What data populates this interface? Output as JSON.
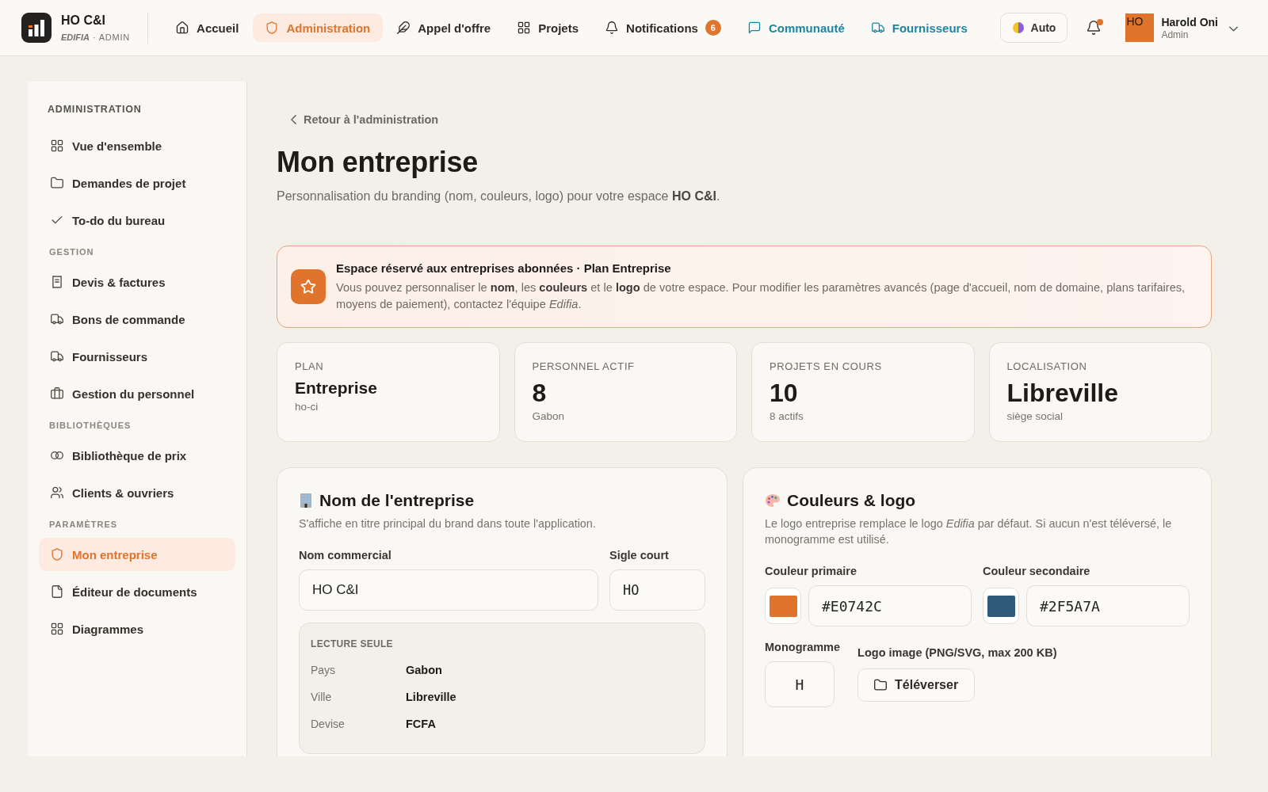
{
  "top_bar": {
    "brand": {
      "name": "HO C&I",
      "tagline": "*EDIFIA* · ADMIN"
    },
    "nav": [
      {
        "label": "Accueil",
        "selected": false,
        "kind": "page"
      },
      {
        "label": "Administration",
        "selected": true,
        "kind": "page"
      },
      {
        "label": "Appel d'offre",
        "selected": false,
        "kind": "page"
      },
      {
        "label": "Projets",
        "selected": false,
        "kind": "page"
      },
      {
        "label": "Notifications",
        "selected": false,
        "kind": "page",
        "badge": "6"
      },
      {
        "label": "Communauté",
        "selected": false,
        "kind": "link"
      },
      {
        "label": "Fournisseurs",
        "selected": false,
        "kind": "link"
      }
    ],
    "theme_button": {
      "label": "Auto"
    },
    "bell": {
      "unread": true
    },
    "user": {
      "avatar": "HO",
      "name": "Harold Oni",
      "role": "Admin"
    }
  },
  "sidebar": {
    "sections": [
      {
        "title": "ADMINISTRATION",
        "kind": "primary",
        "items": [
          {
            "label": "Vue d'ensemble",
            "selected": false
          },
          {
            "label": "Demandes de projet",
            "selected": false
          },
          {
            "label": "To-do du bureau",
            "selected": false
          }
        ]
      },
      {
        "title": "GESTION",
        "kind": "secondary",
        "items": [
          {
            "label": "Devis & factures",
            "selected": false
          },
          {
            "label": "Bons de commande",
            "selected": false
          },
          {
            "label": "Fournisseurs",
            "selected": false
          },
          {
            "label": "Gestion du personnel",
            "selected": false
          }
        ]
      },
      {
        "title": "BIBLIOTHÈQUES",
        "kind": "secondary",
        "items": [
          {
            "label": "Bibliothèque de prix",
            "selected": false
          },
          {
            "label": "Clients & ouvriers",
            "selected": false
          }
        ]
      },
      {
        "title": "PARAMÈTRES",
        "kind": "secondary",
        "items": [
          {
            "label": "Mon entreprise",
            "selected": true
          },
          {
            "label": "Éditeur de documents",
            "selected": false
          },
          {
            "label": "Diagrammes",
            "selected": false
          }
        ]
      }
    ]
  },
  "page": {
    "back_link": "Retour à l'administration",
    "title": "Mon entreprise",
    "subtitle": "Personnalisation du branding (nom, couleurs, logo) pour votre espace **HO C&I**."
  },
  "banner": {
    "title": "Espace réservé aux entreprises abonnées · Plan Entreprise",
    "text": "Vous pouvez personnaliser le **nom**, les **couleurs** et le **logo** de votre espace. Pour modifier les paramètres avancés (page d'accueil, nom de domaine, plans tarifaires, moyens de paiement), contactez l'équipe *Edifia*."
  },
  "stats": [
    {
      "label": "PLAN",
      "value": "Entreprise",
      "note": "ho-ci",
      "kind": "small"
    },
    {
      "label": "PERSONNEL ACTIF",
      "value": "8",
      "note": "Gabon",
      "kind": "large"
    },
    {
      "label": "PROJETS EN COURS",
      "value": "10",
      "note": "8 actifs",
      "kind": "large"
    },
    {
      "label": "LOCALISATION",
      "value": "Libreville",
      "note": "siège social",
      "kind": "large"
    }
  ],
  "name_card": {
    "title": "Nom de l'entreprise",
    "description": "S'affiche en titre principal du brand dans toute l'application.",
    "fields": [
      {
        "label": "Nom commercial",
        "value": "HO C&I",
        "kind": "text"
      },
      {
        "label": "Sigle court",
        "value": "HO",
        "kind": "code"
      }
    ],
    "read_only": {
      "title": "LECTURE SEULE",
      "rows": [
        {
          "label": "Pays",
          "value": "Gabon"
        },
        {
          "label": "Ville",
          "value": "Libreville"
        },
        {
          "label": "Devise",
          "value": "FCFA"
        }
      ]
    }
  },
  "brand_card": {
    "title": "Couleurs & logo",
    "description": "Le logo entreprise remplace le logo *Edifia* par défaut. Si aucun n'est téléversé, le monogramme est utilisé.",
    "colors": [
      {
        "label": "Couleur primaire",
        "value": "#E0742C",
        "color": "#e0742c"
      },
      {
        "label": "Couleur secondaire",
        "value": "#2F5A7A",
        "color": "#2f5a7a"
      }
    ],
    "monogram": {
      "label": "Monogramme",
      "value": "H"
    },
    "logo_upload": {
      "label": "Logo image (PNG/SVG, max 200 KB)",
      "button": "Téléverser"
    }
  }
}
